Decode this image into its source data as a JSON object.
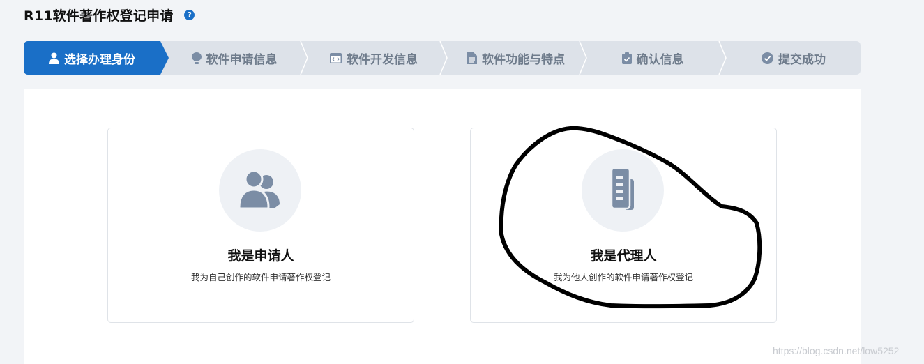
{
  "header": {
    "title": "R11软件著作权登记申请",
    "help_icon": "help-icon"
  },
  "steps": [
    {
      "label": "选择办理身份",
      "icon": "user-icon",
      "active": true
    },
    {
      "label": "软件申请信息",
      "icon": "lightbulb-icon",
      "active": false
    },
    {
      "label": "软件开发信息",
      "icon": "code-window-icon",
      "active": false
    },
    {
      "label": "软件功能与特点",
      "icon": "document-icon",
      "active": false
    },
    {
      "label": "确认信息",
      "icon": "clipboard-check-icon",
      "active": false
    },
    {
      "label": "提交成功",
      "icon": "check-circle-icon",
      "active": false
    }
  ],
  "cards": [
    {
      "title": "我是申请人",
      "desc": "我为自己创作的软件申请著作权登记",
      "icon": "users-icon"
    },
    {
      "title": "我是代理人",
      "desc": "我为他人创作的软件申请著作权登记",
      "icon": "documents-icon"
    }
  ],
  "watermark": "https://blog.csdn.net/low5252",
  "colors": {
    "accent": "#1a6fc7",
    "step_bg": "#dde2e9",
    "step_text": "#6f7c8c",
    "icon_gray": "#7b8da5",
    "page_bg": "#f2f4f7"
  }
}
